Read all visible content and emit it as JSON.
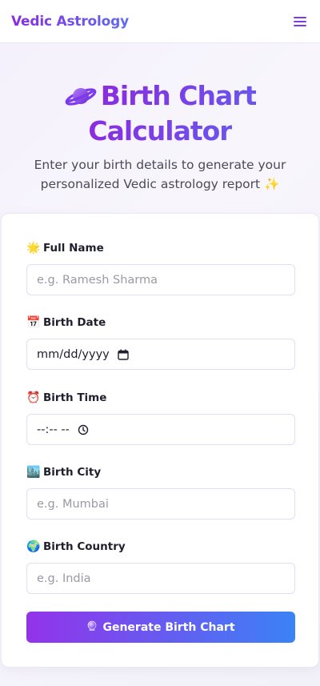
{
  "header": {
    "brand": "Vedic Astrology",
    "menu_icon": "hamburger-menu-icon"
  },
  "hero": {
    "title_icon": "ringed-planet-icon",
    "title_line1": "Birth Chart",
    "title_line2": "Calculator",
    "subtitle": "Enter your birth details to generate your personalized Vedic astrology report ✨"
  },
  "form": {
    "fields": [
      {
        "icon": "🌟",
        "label": "Full Name",
        "placeholder": "e.g. Ramesh Sharma"
      },
      {
        "icon": "📅",
        "label": "Birth Date",
        "value": "mm/dd/yyyy",
        "trailing_icon": "calendar-icon"
      },
      {
        "icon": "⏰",
        "label": "Birth Time",
        "value": "--:-- --",
        "trailing_icon": "clock-icon"
      },
      {
        "icon": "🏙️",
        "label": "Birth City",
        "placeholder": "e.g. Mumbai"
      },
      {
        "icon": "🌍",
        "label": "Birth Country",
        "placeholder": "e.g. India"
      }
    ],
    "submit": {
      "icon": "crystal-ball-icon",
      "label": "Generate Birth Chart"
    }
  },
  "colors": {
    "brand_purple": "#8a2be2",
    "brand_blue": "#3b82f6",
    "title_purple": "#7f3ee8"
  }
}
